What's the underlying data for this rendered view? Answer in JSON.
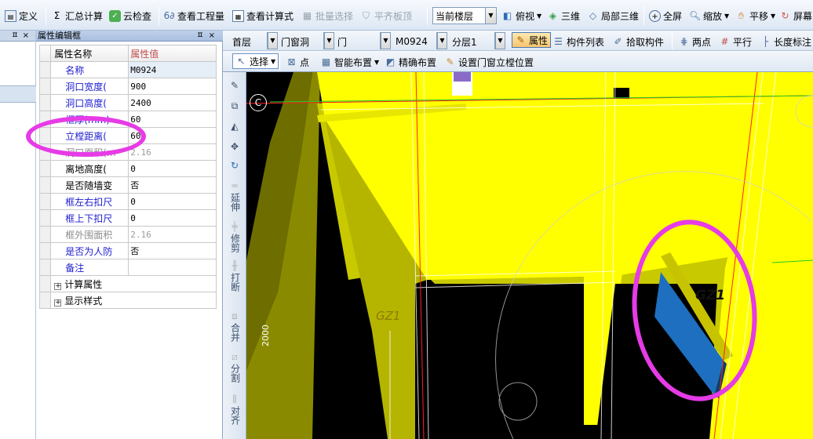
{
  "toolbar": {
    "define": "定义",
    "summary_calc": "汇总计算",
    "cloud_check": "云检查",
    "view_quantity": "查看工程量",
    "view_formula": "查看计算式",
    "batch_select": "批量选择",
    "flat_slab": "平齐板顶",
    "floor_scope": "当前楼层",
    "view_mode": "俯视",
    "view_3d": "三维",
    "partial_3d": "局部三维",
    "fullscreen": "全屏",
    "zoom": "缩放",
    "pan": "平移",
    "screen_rotate": "屏幕"
  },
  "left_strip": {
    "pin": "ㅍ",
    "close": "×"
  },
  "panel": {
    "title": "属性编辑框",
    "pin": "ㅍ",
    "close": "×",
    "header_name": "属性名称",
    "header_value": "属性值",
    "rows": [
      {
        "name": "名称",
        "value": "M0924"
      },
      {
        "name": "洞口宽度(",
        "value": "900"
      },
      {
        "name": "洞口高度(",
        "value": "2400"
      },
      {
        "name": "框厚(mm)",
        "value": "60"
      },
      {
        "name": "立樘距离(",
        "value": "60"
      },
      {
        "name": "洞口面积(m",
        "value": "2.16"
      },
      {
        "name": "离地高度(",
        "value": "0"
      },
      {
        "name": "是否随墙变",
        "value": "否"
      },
      {
        "name": "框左右扣尺",
        "value": "0"
      },
      {
        "name": "框上下扣尺",
        "value": "0"
      },
      {
        "name": "框外围面积",
        "value": "2.16"
      },
      {
        "name": "是否为人防",
        "value": "否"
      },
      {
        "name": "备注",
        "value": ""
      },
      {
        "name": "计算属性",
        "value": ""
      },
      {
        "name": "显示样式",
        "value": ""
      }
    ],
    "expander": "+"
  },
  "filter_bar": {
    "floor": "首层",
    "category": "门窗洞",
    "type": "门",
    "component": "M0924",
    "layer": "分层1",
    "properties": "属性",
    "component_list": "构件列表",
    "pick_component": "拾取构件",
    "two_points": "两点",
    "parallel": "平行",
    "length_dim": "长度标注"
  },
  "draw_bar": {
    "select": "选择",
    "point": "点",
    "smart_place": "智能布置",
    "precise_place": "精确布置",
    "set_frame_position": "设置门窗立樘位置"
  },
  "vertical_tools": {
    "extend": "延伸",
    "trim": "修剪",
    "break": "打断",
    "merge": "合并",
    "split": "分割",
    "align": "对齐"
  },
  "canvas": {
    "axis_label": "C",
    "label_gz1_right": "GZ1",
    "label_gz1_left": "GZ1",
    "dim_text": "2000"
  },
  "colors": {
    "highlight": "#e63be6",
    "slab_yellow": "#ffff00",
    "door_blue": "#1e6fbf",
    "canvas_bg": "#000000"
  }
}
